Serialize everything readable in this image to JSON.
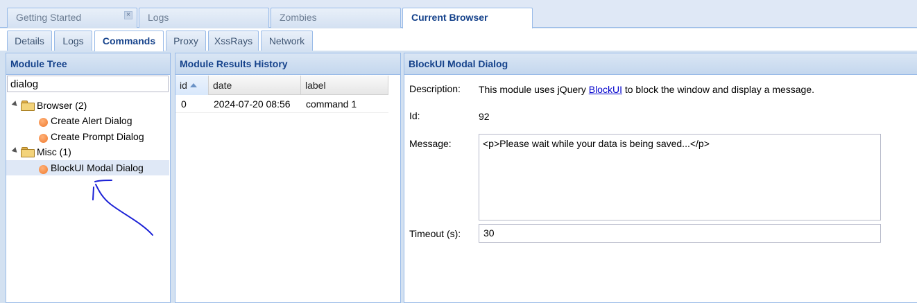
{
  "top_tabs": [
    {
      "label": "Getting Started",
      "closable": true
    },
    {
      "label": "Logs"
    },
    {
      "label": "Zombies"
    },
    {
      "label": "Current Browser",
      "active": true
    }
  ],
  "sub_tabs": [
    {
      "label": "Details"
    },
    {
      "label": "Logs"
    },
    {
      "label": "Commands",
      "active": true
    },
    {
      "label": "Proxy"
    },
    {
      "label": "XssRays"
    },
    {
      "label": "Network"
    }
  ],
  "module_tree": {
    "title": "Module Tree",
    "search_value": "dialog",
    "nodes": [
      {
        "label": "Browser (2)",
        "type": "folder"
      },
      {
        "label": "Create Alert Dialog",
        "type": "module"
      },
      {
        "label": "Create Prompt Dialog",
        "type": "module"
      },
      {
        "label": "Misc (1)",
        "type": "folder"
      },
      {
        "label": "BlockUI Modal Dialog",
        "type": "module",
        "selected": true
      }
    ]
  },
  "results_history": {
    "title": "Module Results History",
    "columns": [
      "id",
      "date",
      "label"
    ],
    "rows": [
      {
        "id": "0",
        "date": "2024-07-20 08:56",
        "label": "command 1"
      }
    ]
  },
  "module_detail": {
    "title": "BlockUI Modal Dialog",
    "description_label": "Description:",
    "description_before": "This module uses jQuery ",
    "description_link": "BlockUI",
    "description_after": " to block the window and display a message.",
    "id_label": "Id:",
    "id_value": "92",
    "message_label": "Message:",
    "message_value": "<p>Please wait while your data is being saved...</p>",
    "timeout_label": "Timeout (s):",
    "timeout_value": "30"
  },
  "colors": {
    "header_text": "#15428b",
    "border": "#99bbe8",
    "selected_row": "#dfe8f6",
    "module_dot": "#f07a2e",
    "annotation_ink": "#1a20d6"
  }
}
